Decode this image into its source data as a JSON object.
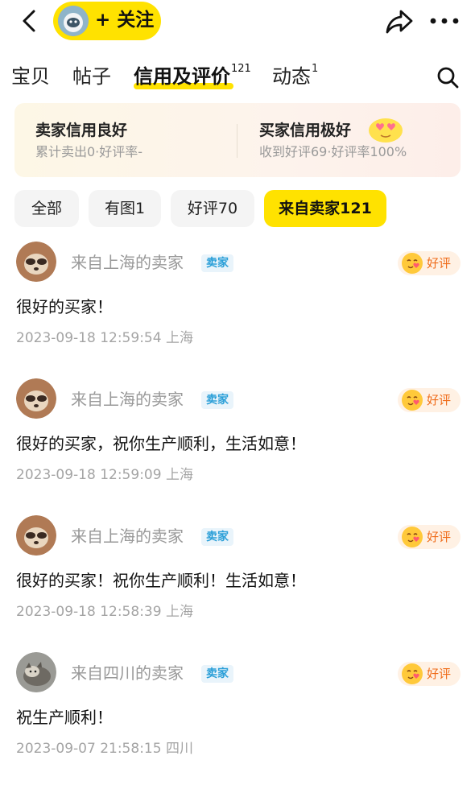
{
  "header": {
    "follow_label": "+ 关注"
  },
  "tabs": [
    {
      "label": "宝贝",
      "count": ""
    },
    {
      "label": "帖子",
      "count": ""
    },
    {
      "label": "信用及评价",
      "count": "121"
    },
    {
      "label": "动态",
      "count": "1"
    }
  ],
  "banner": {
    "left_title": "卖家信用良好",
    "left_sub": "累计卖出0·好评率-",
    "right_title": "买家信用极好",
    "right_sub": "收到好评69·好评率100%"
  },
  "filters": [
    {
      "label": "全部"
    },
    {
      "label": "有图1"
    },
    {
      "label": "好评70"
    },
    {
      "label": "来自卖家121"
    }
  ],
  "reviews": [
    {
      "from": "来自上海的卖家",
      "tag": "卖家",
      "badge": "好评",
      "text": "很好的买家！",
      "time": "2023-09-18 12:59:54 上海"
    },
    {
      "from": "来自上海的卖家",
      "tag": "卖家",
      "badge": "好评",
      "text": "很好的买家，祝你生产顺利，生活如意！",
      "time": "2023-09-18 12:59:09 上海"
    },
    {
      "from": "来自上海的卖家",
      "tag": "卖家",
      "badge": "好评",
      "text": "很好的买家！祝你生产顺利！生活如意！",
      "time": "2023-09-18 12:58:39 上海"
    },
    {
      "from": "来自四川的卖家",
      "tag": "卖家",
      "badge": "好评",
      "text": "祝生产顺利！",
      "time": "2023-09-07 21:58:15 四川"
    }
  ],
  "colors": {
    "accent": "#ffe200",
    "badge_text": "#ef6c1a",
    "tag_text": "#2b9fd8",
    "muted": "#999999"
  },
  "icons": [
    "back-arrow-icon",
    "share-icon",
    "more-icon",
    "search-icon",
    "heart-eyes-emoji-icon",
    "good-review-emoji-icon"
  ]
}
